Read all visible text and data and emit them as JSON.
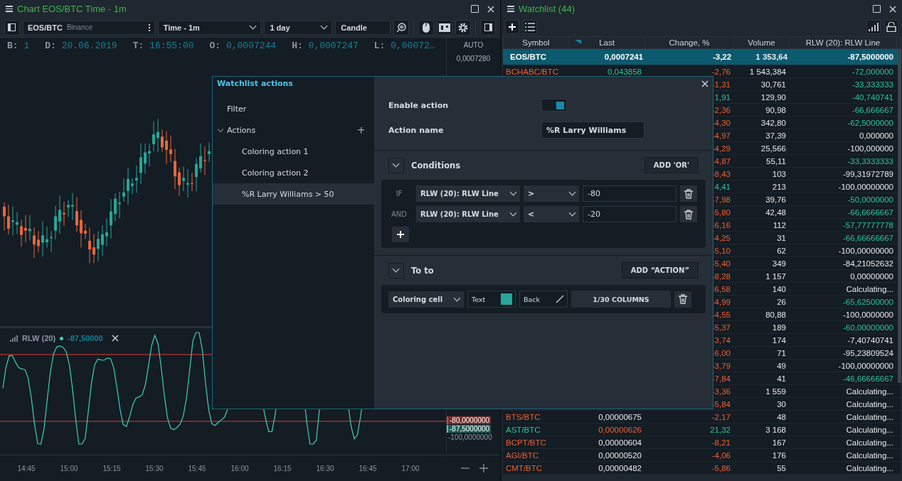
{
  "chart_panel": {
    "title": "Chart EOS/BTC Time - 1m",
    "toolbar": {
      "symbol": "EOS/BTC",
      "exchange": "Binance",
      "timeframe": "Time - 1m",
      "range": "1 day",
      "chart_type": "Candle"
    },
    "info": [
      {
        "label": "B:",
        "value": "1"
      },
      {
        "label": "D:",
        "value": "20.06.2019"
      },
      {
        "label": "T:",
        "value": "16:55:00"
      },
      {
        "label": "O:",
        "value": "0,0007244"
      },
      {
        "label": "H:",
        "value": "0,0007247"
      },
      {
        "label": "L:",
        "value": "0,00072…"
      }
    ],
    "scale_mode": "AUTO",
    "price_labels": [
      "0,0007280"
    ],
    "indicator": {
      "name": "RLW (20)",
      "value": "-87,50000",
      "axis_labels": [
        {
          "text": "-80,0000000",
          "kind": "level"
        },
        {
          "text": "-87,5000000",
          "kind": "current"
        },
        {
          "text": "-100,0000000",
          "kind": "plain"
        }
      ]
    },
    "time_labels": [
      "14:45",
      "15:00",
      "15:15",
      "15:30",
      "15:45",
      "16:00",
      "16:15",
      "16:30",
      "16:45",
      "17:00"
    ]
  },
  "watchlist": {
    "title": "Watchlist (44)",
    "columns": [
      "Symbol",
      "Last",
      "Change, %",
      "Volume",
      "RLW (20): RLW Line"
    ],
    "rows": [
      {
        "symbol": {
          "text": "EOS/BTC",
          "color": "#ffffff"
        },
        "last": {
          "text": "0,0007241",
          "color": "#ffffff"
        },
        "change": {
          "text": "-3,22",
          "color": "#ffffff"
        },
        "volume": "1 353,64",
        "rlw": {
          "text": "-87,5000000",
          "color": "#ffffff"
        },
        "selected": true
      },
      {
        "symbol": {
          "text": "BCHABC/BTC",
          "color": "#ea6234"
        },
        "last": {
          "text": "0,043858",
          "color": "#2fc49c"
        },
        "change": {
          "text": "-2,76",
          "color": "#ea6234"
        },
        "volume": "1 543,384",
        "rlw": {
          "text": "-72,000000",
          "color": "#2fc49c"
        },
        "selected": false
      },
      {
        "change": {
          "text": "-1,31",
          "color": "#ea6234"
        },
        "volume": "30,761",
        "rlw": {
          "text": "-33,333333",
          "color": "#2fc49c"
        },
        "selected": false
      },
      {
        "change": {
          "text": "1,91",
          "color": "#2fc49c"
        },
        "volume": "129,90",
        "rlw": {
          "text": "-40,740741",
          "color": "#2fc49c"
        },
        "selected": false
      },
      {
        "change": {
          "text": "-2,36",
          "color": "#ea6234"
        },
        "volume": "90,98",
        "rlw": {
          "text": "-66,666667",
          "color": "#2fc49c"
        },
        "selected": false
      },
      {
        "change": {
          "text": "-4,30",
          "color": "#ea6234"
        },
        "volume": "342,80",
        "rlw": {
          "text": "-62,5000000",
          "color": "#2fc49c"
        },
        "selected": false
      },
      {
        "change": {
          "text": "-4,97",
          "color": "#ea6234"
        },
        "volume": "37,39",
        "rlw": {
          "text": "0,000000",
          "color": "#e6eaee"
        },
        "selected": false
      },
      {
        "change": {
          "text": "-4,29",
          "color": "#ea6234"
        },
        "volume": "25,566",
        "rlw": {
          "text": "-100,000000",
          "color": "#e6eaee"
        },
        "selected": false
      },
      {
        "change": {
          "text": "-4,87",
          "color": "#ea6234"
        },
        "volume": "55,11",
        "rlw": {
          "text": "-33,3333333",
          "color": "#2fc49c"
        },
        "selected": false
      },
      {
        "change": {
          "text": "-8,43",
          "color": "#ea6234"
        },
        "volume": "103",
        "rlw": {
          "text": "-99,31972789",
          "color": "#e6eaee"
        },
        "selected": false
      },
      {
        "change": {
          "text": "4,41",
          "color": "#2fc49c"
        },
        "volume": "213",
        "rlw": {
          "text": "-100,00000000",
          "color": "#e6eaee"
        },
        "selected": false
      },
      {
        "change": {
          "text": "-7,98",
          "color": "#ea6234"
        },
        "volume": "39,76",
        "rlw": {
          "text": "-50,0000000",
          "color": "#2fc49c"
        },
        "selected": false
      },
      {
        "change": {
          "text": "-5,80",
          "color": "#ea6234"
        },
        "volume": "42,48",
        "rlw": {
          "text": "-66,6666667",
          "color": "#2fc49c"
        },
        "selected": false
      },
      {
        "change": {
          "text": "-6,16",
          "color": "#ea6234"
        },
        "volume": "112",
        "rlw": {
          "text": "-57,77777778",
          "color": "#2fc49c"
        },
        "selected": false
      },
      {
        "change": {
          "text": "-4,25",
          "color": "#ea6234"
        },
        "volume": "31",
        "rlw": {
          "text": "-66,66666667",
          "color": "#2fc49c"
        },
        "selected": false
      },
      {
        "change": {
          "text": "-5,10",
          "color": "#ea6234"
        },
        "volume": "62",
        "rlw": {
          "text": "-100,00000000",
          "color": "#e6eaee"
        },
        "selected": false
      },
      {
        "change": {
          "text": "-5,40",
          "color": "#ea6234"
        },
        "volume": "349",
        "rlw": {
          "text": "-84,21052632",
          "color": "#e6eaee"
        },
        "selected": false
      },
      {
        "change": {
          "text": "-8,28",
          "color": "#ea6234"
        },
        "volume": "1 157",
        "rlw": {
          "text": "0,00000000",
          "color": "#e6eaee"
        },
        "selected": false
      },
      {
        "change": {
          "text": "-6,58",
          "color": "#ea6234"
        },
        "volume": "140",
        "rlw": {
          "text": "Calculating...",
          "color": "#e6eaee"
        },
        "selected": false
      },
      {
        "change": {
          "text": "-4,99",
          "color": "#ea6234"
        },
        "volume": "26",
        "rlw": {
          "text": "-65,62500000",
          "color": "#2fc49c"
        },
        "selected": false
      },
      {
        "change": {
          "text": "-4,55",
          "color": "#ea6234"
        },
        "volume": "80,88",
        "rlw": {
          "text": "-100,0000000",
          "color": "#e6eaee"
        },
        "selected": false
      },
      {
        "change": {
          "text": "-5,37",
          "color": "#ea6234"
        },
        "volume": "189",
        "rlw": {
          "text": "-60,00000000",
          "color": "#2fc49c"
        },
        "selected": false
      },
      {
        "change": {
          "text": "-3,74",
          "color": "#ea6234"
        },
        "volume": "174",
        "rlw": {
          "text": "-7,40740741",
          "color": "#e6eaee"
        },
        "selected": false
      },
      {
        "change": {
          "text": "-6,00",
          "color": "#ea6234"
        },
        "volume": "71",
        "rlw": {
          "text": "-95,23809524",
          "color": "#e6eaee"
        },
        "selected": false
      },
      {
        "change": {
          "text": "-3,79",
          "color": "#ea6234"
        },
        "volume": "49",
        "rlw": {
          "text": "-100,00000000",
          "color": "#e6eaee"
        },
        "selected": false
      },
      {
        "change": {
          "text": "-7,84",
          "color": "#ea6234"
        },
        "volume": "41",
        "rlw": {
          "text": "-46,66666667",
          "color": "#2fc49c"
        },
        "selected": false
      },
      {
        "change": {
          "text": "-3,36",
          "color": "#ea6234"
        },
        "volume": "1 559",
        "rlw": {
          "text": "Calculating...",
          "color": "#e6eaee"
        },
        "selected": false
      },
      {
        "change": {
          "text": "-5,84",
          "color": "#ea6234"
        },
        "volume": "30",
        "rlw": {
          "text": "Calculating...",
          "color": "#e6eaee"
        },
        "selected": false
      },
      {
        "symbol": {
          "text": "BTS/BTC",
          "color": "#ea6234"
        },
        "last": {
          "text": "0,00000675",
          "color": "#e6eaee"
        },
        "change": {
          "text": "-2,17",
          "color": "#ea6234"
        },
        "volume": "48",
        "rlw": {
          "text": "Calculating...",
          "color": "#e6eaee"
        },
        "selected": false
      },
      {
        "symbol": {
          "text": "AST/BTC",
          "color": "#2fc49c"
        },
        "last": {
          "text": "0,00000626",
          "color": "#ea6234"
        },
        "change": {
          "text": "21,32",
          "color": "#2fc49c"
        },
        "volume": "3 168",
        "rlw": {
          "text": "Calculating...",
          "color": "#e6eaee"
        },
        "selected": false
      },
      {
        "symbol": {
          "text": "BCPT/BTC",
          "color": "#ea6234"
        },
        "last": {
          "text": "0,00000604",
          "color": "#e6eaee"
        },
        "change": {
          "text": "-8,21",
          "color": "#ea6234"
        },
        "volume": "167",
        "rlw": {
          "text": "Calculating...",
          "color": "#e6eaee"
        },
        "selected": false
      },
      {
        "symbol": {
          "text": "AGI/BTC",
          "color": "#ea6234"
        },
        "last": {
          "text": "0,00000520",
          "color": "#e6eaee"
        },
        "change": {
          "text": "-4,06",
          "color": "#ea6234"
        },
        "volume": "176",
        "rlw": {
          "text": "Calculating...",
          "color": "#e6eaee"
        },
        "selected": false
      },
      {
        "symbol": {
          "text": "CMT/BTC",
          "color": "#ea6234"
        },
        "last": {
          "text": "0,00000482",
          "color": "#e6eaee"
        },
        "change": {
          "text": "-5,86",
          "color": "#ea6234"
        },
        "volume": "55",
        "rlw": {
          "text": "Calculating...",
          "color": "#e6eaee"
        },
        "selected": false
      }
    ]
  },
  "dialog": {
    "title": "Watchlist actions",
    "nav": [
      {
        "label": "Filter",
        "selected": false
      },
      {
        "label": "Actions",
        "selected": false,
        "expanded": true,
        "children": [
          {
            "label": "Coloring action 1",
            "selected": false
          },
          {
            "label": "Coloring action 2",
            "selected": false
          },
          {
            "label": "%R Larry Williams > 50",
            "selected": true
          }
        ]
      }
    ],
    "enable_label": "Enable action",
    "enabled": true,
    "name_label": "Action name",
    "name_value": "%R Larry Williams",
    "conditions": {
      "title": "Conditions",
      "expanded": true,
      "button": "ADD 'OR'",
      "rows": [
        {
          "connector": "IF",
          "indicator": "RLW (20): RLW Line",
          "operator": ">",
          "value": "-80"
        },
        {
          "connector": "AND",
          "indicator": "RLW (20): RLW Line",
          "operator": "<",
          "value": "-20"
        }
      ]
    },
    "actions": {
      "title": "To to",
      "expanded": true,
      "button": "ADD “ACTION”",
      "rows": [
        {
          "type": "Coloring cell",
          "text_picker": {
            "label": "Text",
            "color": "#26a69a"
          },
          "back_label": "Back",
          "columns": "1/30 COLUMNS"
        }
      ]
    }
  }
}
